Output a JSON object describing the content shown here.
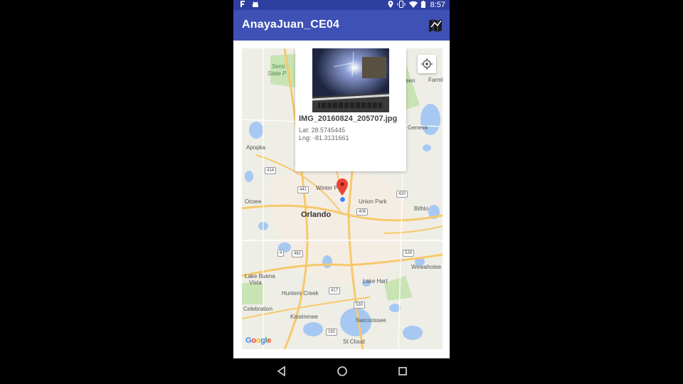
{
  "status_bar": {
    "time": "8:57",
    "left_icons": [
      "app-notification-icon",
      "android-debug-icon"
    ],
    "right_icons": [
      "location-icon",
      "vibrate-icon",
      "wifi-icon",
      "battery-icon"
    ],
    "color": "#2f3fa0"
  },
  "app_bar": {
    "title": "AnayaJuan_CE04",
    "action_icon": "map-icon",
    "color": "#3f51b5"
  },
  "info_window": {
    "file_name": "IMG_20160824_205707.jpg",
    "lat": "Lat: 28.5745445",
    "lng": "Lng: -81.3131661"
  },
  "map": {
    "labels": {
      "seminole_a": "Semi",
      "seminole_b": "State P",
      "apopka": "Apopka",
      "winter_park": "Winter P",
      "ocoee": "Ocoee",
      "orlando": "Orlando",
      "union_park": "Union Park",
      "bithlo": "Bithlo",
      "geneva": "Geneva",
      "farm": "Farml",
      "teen": "teen",
      "lake_buena_a": "Lake Buena",
      "lake_buena_b": "Vista",
      "hunters_creek": "Hunters Creek",
      "lake_hart": "Lake Hart",
      "wewahootee": "Wewahotee",
      "celebration": "Celebration",
      "kissimmee": "Kissimmee",
      "narcoossee": "Narcoossee",
      "st_cloud": "St Cloud"
    },
    "shields": {
      "s414": "414",
      "s441": "441",
      "s420": "420",
      "s408": "408",
      "s4": "4",
      "s482": "482",
      "s528": "528",
      "s417": "417",
      "s530": "530",
      "s192": "192"
    },
    "attribution": "Google",
    "accent_road": "#f6c96b",
    "water": "#a7c8f2",
    "park": "#c8e3b4"
  },
  "nav_bar": {
    "icons": [
      "back-icon",
      "home-icon",
      "recents-icon"
    ]
  }
}
